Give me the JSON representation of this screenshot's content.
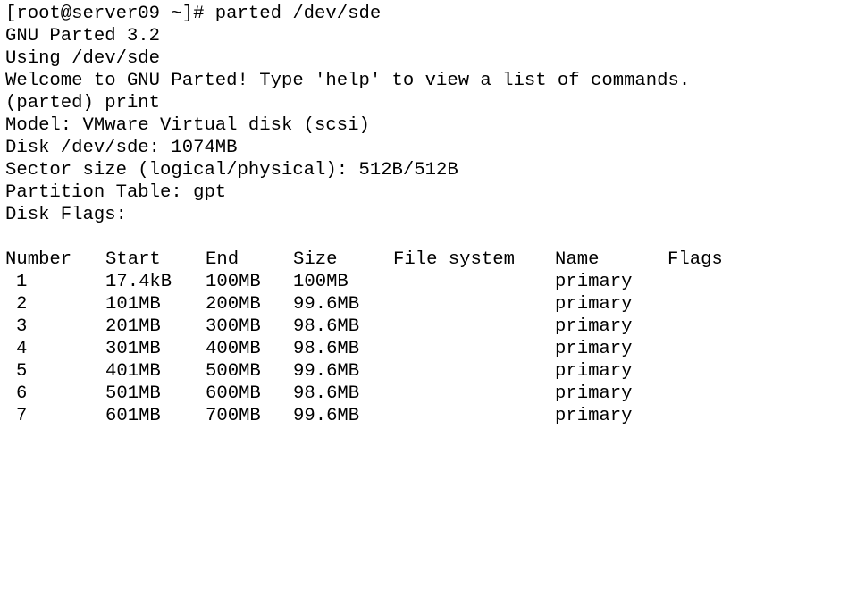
{
  "terminal": {
    "lines": [
      "[root@server09 ~]# parted /dev/sde",
      "GNU Parted 3.2",
      "Using /dev/sde",
      "Welcome to GNU Parted! Type 'help' to view a list of commands.",
      "(parted) print",
      "Model: VMware Virtual disk (scsi)",
      "Disk /dev/sde: 1074MB",
      "Sector size (logical/physical): 512B/512B",
      "Partition Table: gpt",
      "Disk Flags:"
    ],
    "table": {
      "headers": {
        "number": "Number",
        "start": "Start",
        "end": "End",
        "size": "Size",
        "fs": "File system",
        "name": "Name",
        "flags": "Flags"
      },
      "rows": [
        {
          "number": "1",
          "start": "17.4kB",
          "end": "100MB",
          "size": "100MB",
          "fs": "",
          "name": "primary",
          "flags": ""
        },
        {
          "number": "2",
          "start": "101MB",
          "end": "200MB",
          "size": "99.6MB",
          "fs": "",
          "name": "primary",
          "flags": ""
        },
        {
          "number": "3",
          "start": "201MB",
          "end": "300MB",
          "size": "98.6MB",
          "fs": "",
          "name": "primary",
          "flags": ""
        },
        {
          "number": "4",
          "start": "301MB",
          "end": "400MB",
          "size": "98.6MB",
          "fs": "",
          "name": "primary",
          "flags": ""
        },
        {
          "number": "5",
          "start": "401MB",
          "end": "500MB",
          "size": "99.6MB",
          "fs": "",
          "name": "primary",
          "flags": ""
        },
        {
          "number": "6",
          "start": "501MB",
          "end": "600MB",
          "size": "98.6MB",
          "fs": "",
          "name": "primary",
          "flags": ""
        },
        {
          "number": "7",
          "start": "601MB",
          "end": "700MB",
          "size": "99.6MB",
          "fs": "",
          "name": "primary",
          "flags": ""
        }
      ]
    }
  }
}
